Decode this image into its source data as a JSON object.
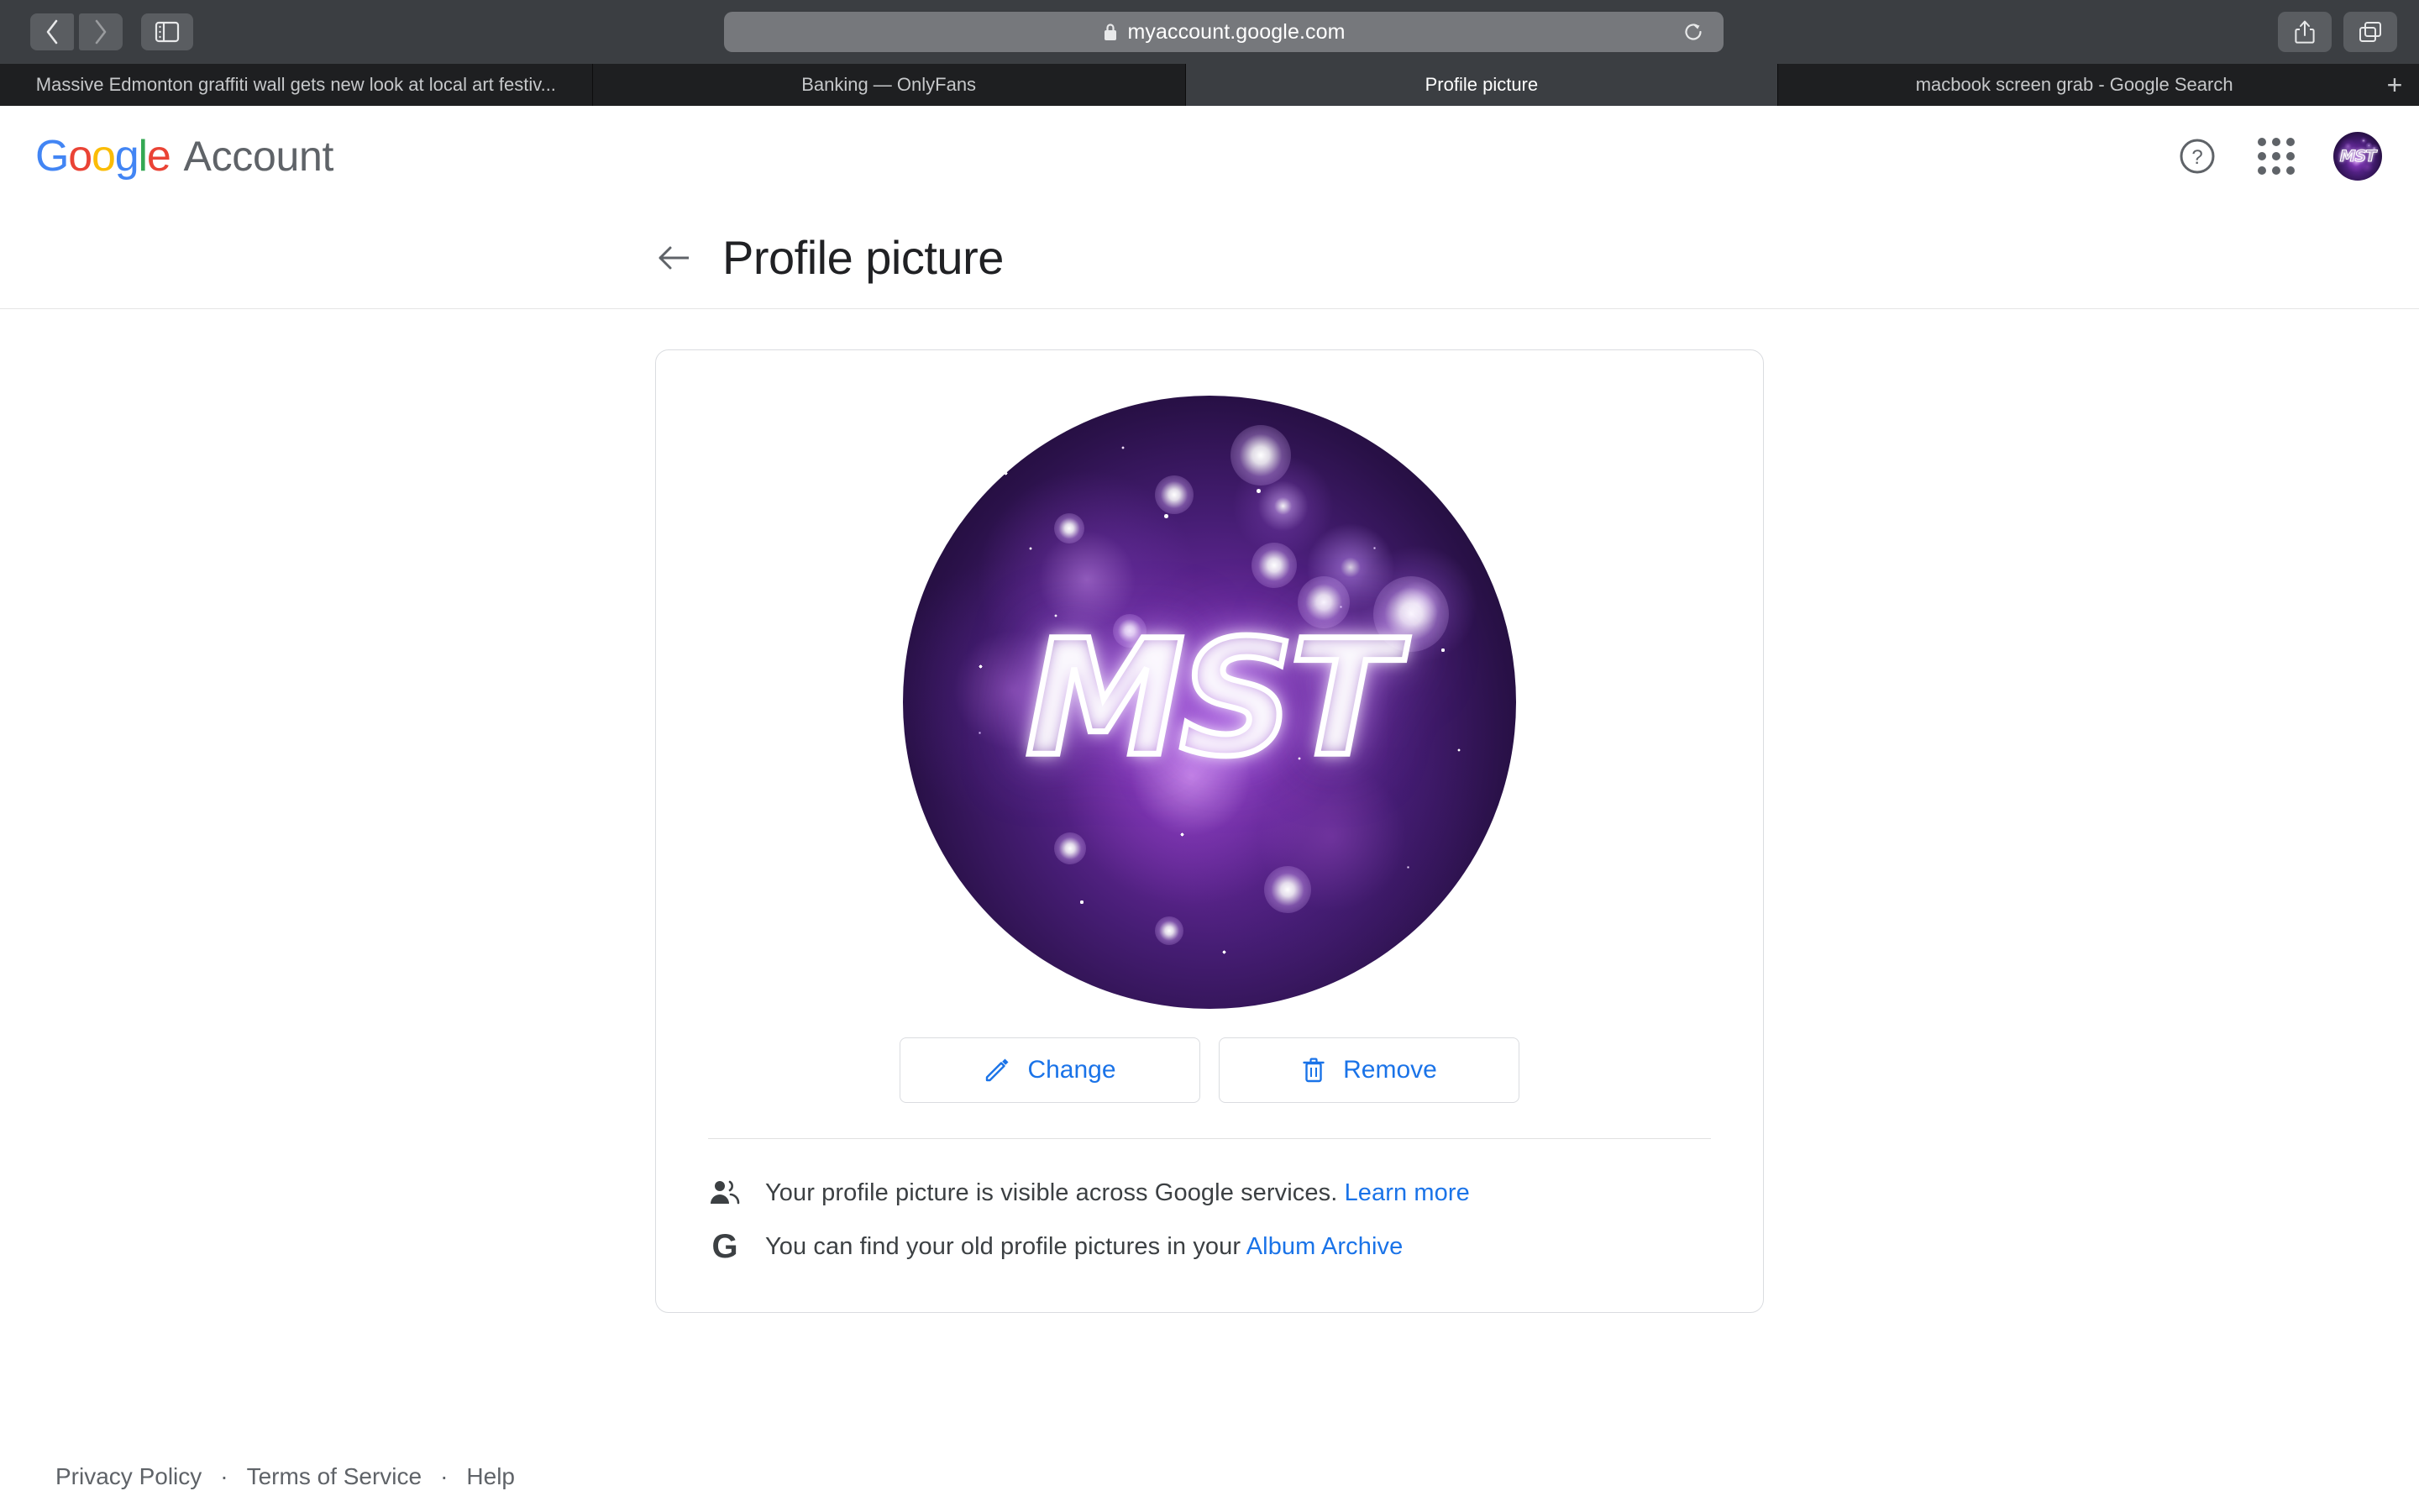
{
  "browser": {
    "url": "myaccount.google.com",
    "lock_icon": "lock-icon",
    "back_icon": "chevron-left-icon",
    "forward_icon": "chevron-right-icon",
    "sidebar_icon": "sidebar-toggle-icon",
    "reload_icon": "reload-icon",
    "share_icon": "share-icon",
    "tabs_overview_icon": "tabs-overview-icon",
    "new_tab_label": "+",
    "tabs": [
      {
        "label": "Massive Edmonton graffiti wall gets new look at local art festiv...",
        "active": false
      },
      {
        "label": "Banking — OnlyFans",
        "active": false
      },
      {
        "label": "Profile picture",
        "active": true
      },
      {
        "label": "macbook screen grab - Google Search",
        "active": false
      }
    ]
  },
  "header": {
    "logo": {
      "letters": [
        {
          "char": "G",
          "color": "#4285F4"
        },
        {
          "char": "o",
          "color": "#EA4335"
        },
        {
          "char": "o",
          "color": "#FBBC05"
        },
        {
          "char": "g",
          "color": "#4285F4"
        },
        {
          "char": "l",
          "color": "#34A853"
        },
        {
          "char": "e",
          "color": "#EA4335"
        }
      ],
      "product": "Account"
    },
    "help_icon": "help-circle-icon",
    "apps_icon": "apps-grid-icon",
    "avatar_alt": "MST"
  },
  "page": {
    "back_icon": "arrow-left-icon",
    "title": "Profile picture"
  },
  "card": {
    "avatar": {
      "text": "MST",
      "alt": "MST galaxy profile picture"
    },
    "buttons": [
      {
        "label": "Change",
        "icon": "pencil-icon"
      },
      {
        "label": "Remove",
        "icon": "trash-icon"
      }
    ],
    "info": [
      {
        "icon": "people-icon",
        "text": "Your profile picture is visible across Google services.",
        "link": "Learn more"
      },
      {
        "icon": "google-g-icon",
        "text": "You can find your old profile pictures in your",
        "link": "Album Archive"
      }
    ]
  },
  "footer": {
    "links": [
      "Privacy Policy",
      "Terms of Service",
      "Help"
    ],
    "separator": "·"
  },
  "colors": {
    "google_blue": "#1a73e8",
    "text_primary": "#202124",
    "text_secondary": "#5f6368",
    "border": "#dadce0",
    "chrome_bg": "#3b3e42",
    "tabbar_bg": "#1e1f21"
  }
}
